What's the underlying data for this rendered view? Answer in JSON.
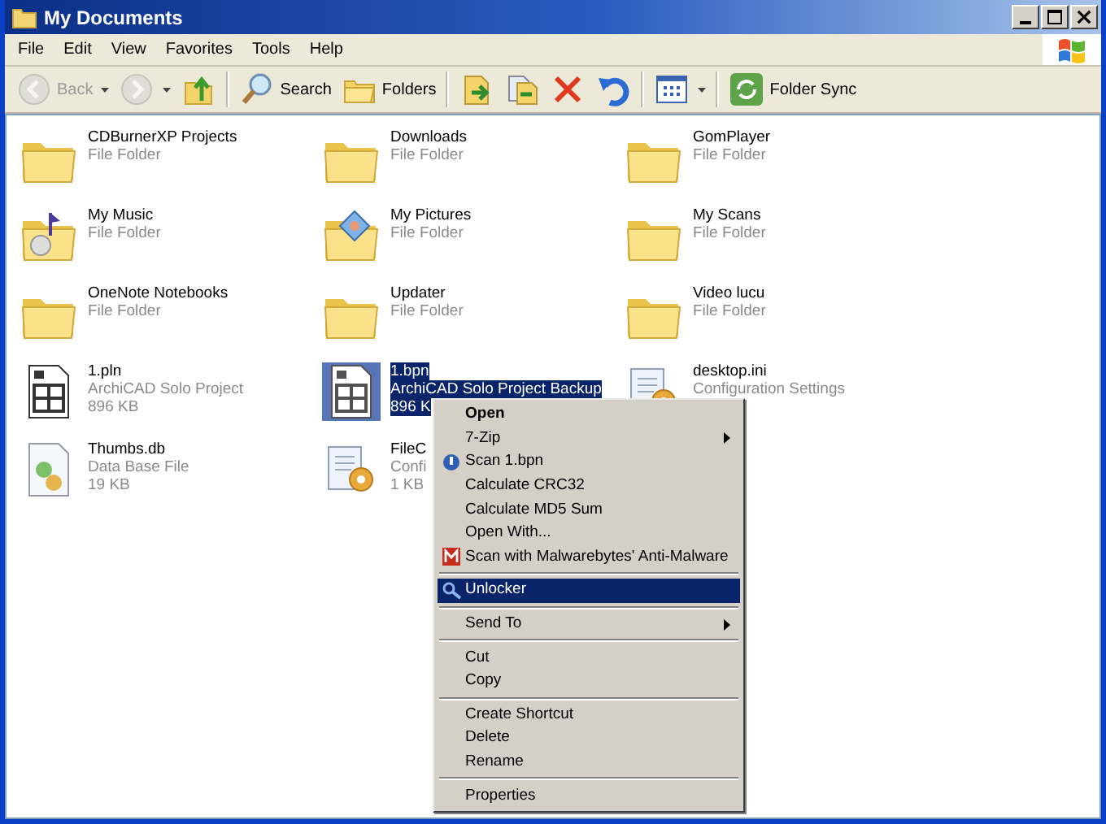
{
  "window": {
    "title": "My Documents"
  },
  "menu_bar": [
    "File",
    "Edit",
    "View",
    "Favorites",
    "Tools",
    "Help"
  ],
  "toolbar": [
    {
      "kind": "back",
      "label": "Back",
      "disabled": true,
      "dropdown": true
    },
    {
      "kind": "forward",
      "disabled": true,
      "dropdown": true
    },
    {
      "kind": "up",
      "disabled": false,
      "dropdown": false
    },
    {
      "kind": "search",
      "label": "Search",
      "disabled": false,
      "dropdown": false
    },
    {
      "kind": "folders",
      "label": "Folders",
      "disabled": false,
      "dropdown": false
    },
    {
      "kind": "move",
      "disabled": false,
      "dropdown": false
    },
    {
      "kind": "copy",
      "disabled": false,
      "dropdown": false
    },
    {
      "kind": "delete",
      "disabled": false,
      "dropdown": false
    },
    {
      "kind": "undo",
      "disabled": false,
      "dropdown": false
    },
    {
      "kind": "views",
      "disabled": false,
      "dropdown": true
    },
    {
      "kind": "sync",
      "label": "Folder Sync",
      "disabled": false,
      "dropdown": false
    }
  ],
  "items": [
    {
      "kind": "folder",
      "name": "CDBurnerXP Projects",
      "type": "File Folder",
      "selected": false
    },
    {
      "kind": "folder",
      "name": "Downloads",
      "type": "File Folder",
      "selected": false
    },
    {
      "kind": "folder",
      "name": "GomPlayer",
      "type": "File Folder",
      "selected": false
    },
    {
      "kind": "music-folder",
      "name": "My Music",
      "type": "File Folder",
      "selected": false
    },
    {
      "kind": "pictures-folder",
      "name": "My Pictures",
      "type": "File Folder",
      "selected": false
    },
    {
      "kind": "folder",
      "name": "My Scans",
      "type": "File Folder",
      "selected": false
    },
    {
      "kind": "folder",
      "name": "OneNote Notebooks",
      "type": "File Folder",
      "selected": false
    },
    {
      "kind": "folder",
      "name": "Updater",
      "type": "File Folder",
      "selected": false
    },
    {
      "kind": "folder",
      "name": "Video lucu",
      "type": "File Folder",
      "selected": false
    },
    {
      "kind": "plan",
      "name": "1.pln",
      "type": "ArchiCAD Solo Project",
      "size": "896 KB",
      "selected": false
    },
    {
      "kind": "plan",
      "name": "1.bpn",
      "type": "ArchiCAD Solo Project Backup",
      "size": "896 K",
      "selected": true
    },
    {
      "kind": "config",
      "name": "desktop.ini",
      "type": "Configuration Settings",
      "selected": false
    },
    {
      "kind": "database",
      "name": "Thumbs.db",
      "type": "Data Base File",
      "size": "19 KB",
      "selected": false
    },
    {
      "kind": "config",
      "name": "FileC",
      "type": "Confi",
      "size": "1 KB",
      "selected": false
    }
  ],
  "context_menu": {
    "groups": [
      [
        {
          "label": "Open",
          "default": true,
          "submenu": false,
          "selected": false
        },
        {
          "label": "7-Zip",
          "default": false,
          "submenu": true,
          "selected": false
        },
        {
          "label": "Scan 1.bpn",
          "kind": "scan",
          "default": false,
          "submenu": false,
          "selected": false
        },
        {
          "label": "Calculate CRC32",
          "default": false,
          "submenu": false,
          "selected": false
        },
        {
          "label": "Calculate MD5 Sum",
          "default": false,
          "submenu": false,
          "selected": false
        },
        {
          "label": "Open With...",
          "default": false,
          "submenu": false,
          "selected": false
        },
        {
          "label": "Scan with Malwarebytes' Anti-Malware",
          "kind": "malware",
          "default": false,
          "submenu": false,
          "selected": false
        }
      ],
      [
        {
          "label": "Unlocker",
          "kind": "unlocker",
          "default": false,
          "submenu": false,
          "selected": true
        }
      ],
      [
        {
          "label": "Send To",
          "default": false,
          "submenu": true,
          "selected": false
        }
      ],
      [
        {
          "label": "Cut",
          "default": false,
          "submenu": false,
          "selected": false
        },
        {
          "label": "Copy",
          "default": false,
          "submenu": false,
          "selected": false
        }
      ],
      [
        {
          "label": "Create Shortcut",
          "default": false,
          "submenu": false,
          "selected": false
        },
        {
          "label": "Delete",
          "default": false,
          "submenu": false,
          "selected": false
        },
        {
          "label": "Rename",
          "default": false,
          "submenu": false,
          "selected": false
        }
      ],
      [
        {
          "label": "Properties",
          "default": false,
          "submenu": false,
          "selected": false
        }
      ]
    ]
  }
}
